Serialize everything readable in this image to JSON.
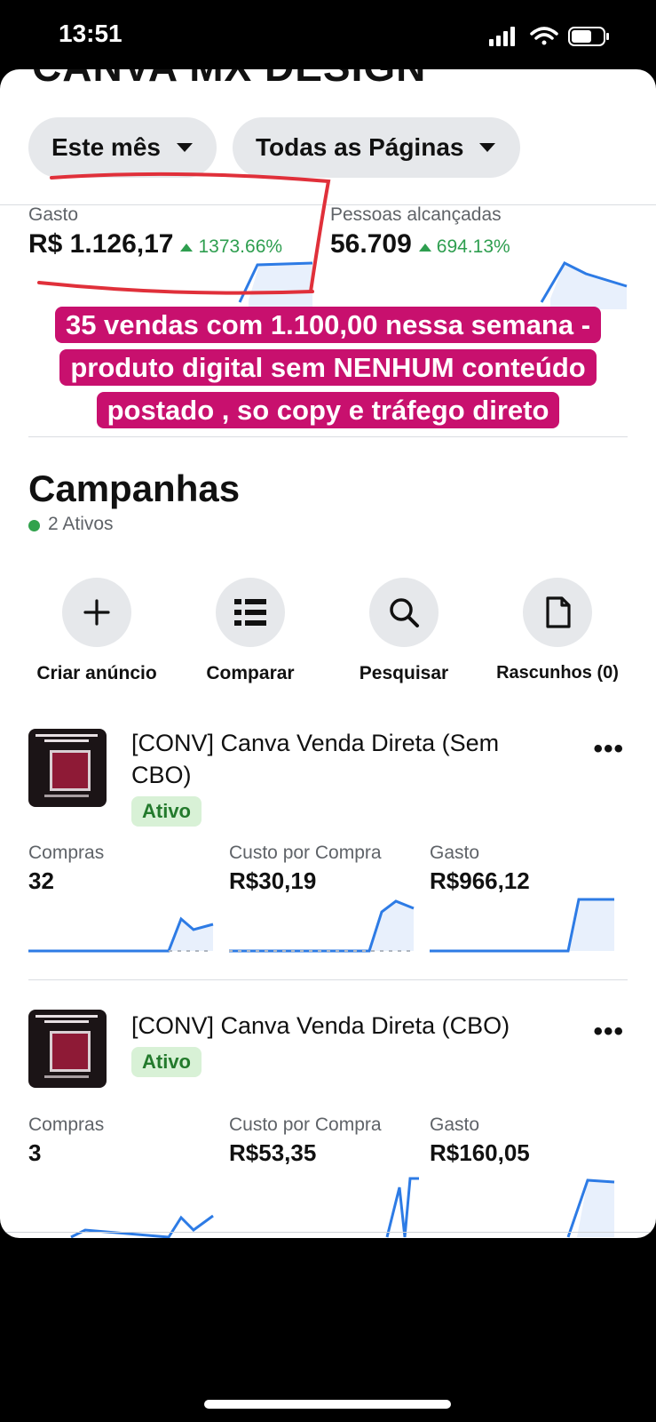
{
  "status_bar": {
    "time": "13:51"
  },
  "header": {
    "cut_title": "CANVA MX DESIGN"
  },
  "filters": {
    "period": "Este mês",
    "pages": "Todas as Páginas"
  },
  "summary": {
    "spend": {
      "label": "Gasto",
      "value": "R$ 1.126,17",
      "delta": "1373.66%"
    },
    "reach": {
      "label": "Pessoas alcançadas",
      "value": "56.709",
      "delta": "694.13%"
    }
  },
  "overlay": {
    "line1": "35 vendas com 1.100,00 nessa semana -",
    "line2": "produto digital sem NENHUM conteúdo",
    "line3": "postado , so copy e tráfego direto"
  },
  "campaigns_section": {
    "title": "Campanhas",
    "active_count": "2 Ativos"
  },
  "actions": {
    "create": "Criar anúncio",
    "compare": "Comparar",
    "search": "Pesquisar",
    "drafts": "Rascunhos (0)"
  },
  "campaigns": [
    {
      "title_line1": "[CONV] Canva Venda Direta (Sem",
      "title_line2": "CBO)",
      "status": "Ativo",
      "purchases_label": "Compras",
      "purchases": "32",
      "cpp_label": "Custo por Compra",
      "cpp": "R$30,19",
      "spend_label": "Gasto",
      "spend": "R$966,12"
    },
    {
      "title_line1": "[CONV] Canva Venda Direta (CBO)",
      "status": "Ativo",
      "purchases_label": "Compras",
      "purchases": "3",
      "cpp_label": "Custo por Compra",
      "cpp": "R$53,35",
      "spend_label": "Gasto",
      "spend": "R$160,05"
    }
  ],
  "colors": {
    "accent_blue": "#2d7be5",
    "active_green": "#31a24c",
    "overlay_pink": "#c8106e",
    "annotation_red": "#e0303a"
  }
}
